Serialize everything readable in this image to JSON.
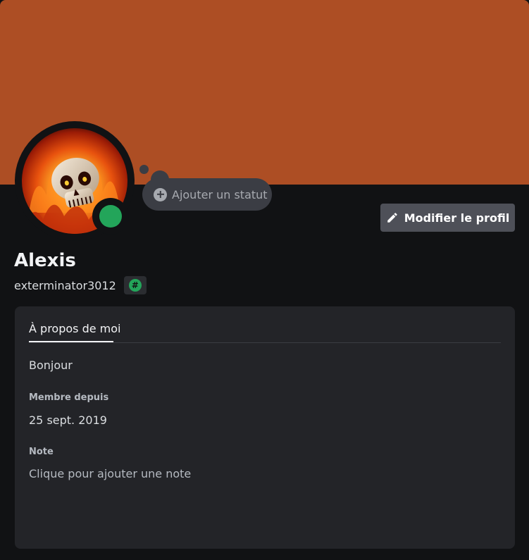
{
  "colors": {
    "banner": "#ad4e24",
    "status_online": "#23a55a"
  },
  "status_prompt": {
    "icon": "plus-circle-icon",
    "label": "Ajouter un statut"
  },
  "edit_profile": {
    "icon": "pencil-icon",
    "label": "Modifier le profil"
  },
  "user": {
    "display_name": "Alexis",
    "username": "exterminator3012",
    "badge": {
      "icon": "hash-badge-icon",
      "glyph": "#"
    },
    "status": "online"
  },
  "about_card": {
    "tab_label": "À propos de moi",
    "about_text": "Bonjour",
    "member_since_label": "Membre depuis",
    "member_since_value": "25 sept. 2019",
    "note_label": "Note",
    "note_placeholder": "Clique pour ajouter une note"
  }
}
